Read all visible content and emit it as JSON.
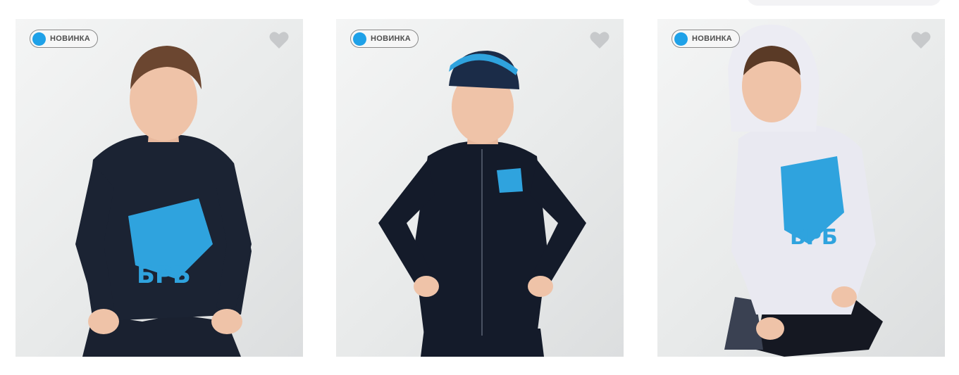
{
  "products": [
    {
      "badge": "НОВИНКА",
      "shirt_color": "#1b2333",
      "print_color": "#2fa3de"
    },
    {
      "badge": "НОВИНКА",
      "shirt_color": "#141b2a",
      "print_color": "#2fa3de"
    },
    {
      "badge": "НОВИНКА",
      "shirt_color": "#e9e9f1",
      "print_color": "#2fa3de"
    }
  ],
  "colors": {
    "badge_dot": "#1ea1e8",
    "heart": "#c7c9cb"
  },
  "icons": {
    "favorite": "heart-icon"
  }
}
